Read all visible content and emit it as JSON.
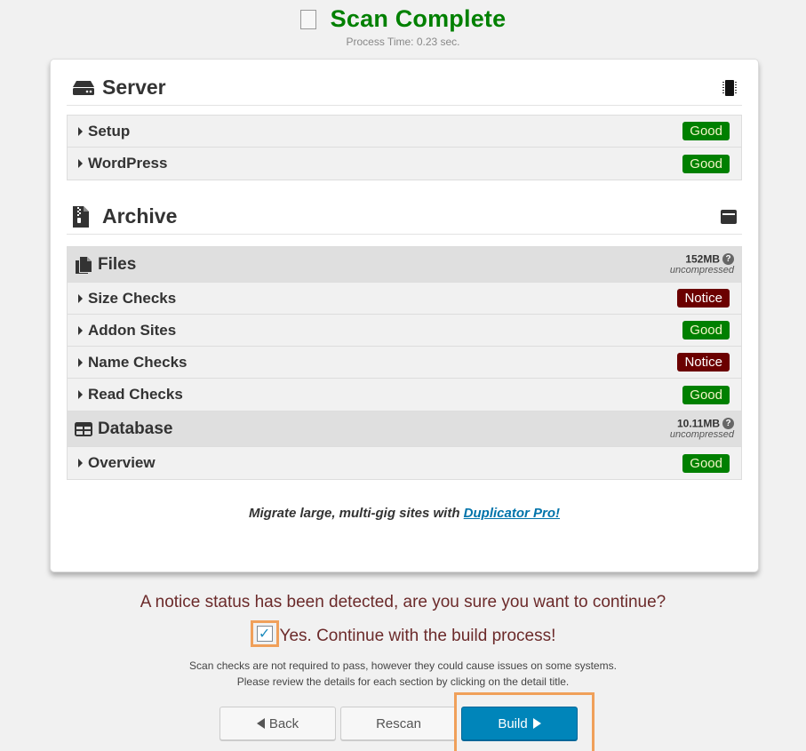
{
  "header": {
    "title": "Scan Complete",
    "process_time": "Process Time: 0.23 sec."
  },
  "server": {
    "title": "Server",
    "icon": "server-icon",
    "right_icon": "chip-icon",
    "items": [
      {
        "label": "Setup",
        "status": "Good"
      },
      {
        "label": "WordPress",
        "status": "Good"
      }
    ]
  },
  "archive": {
    "title": "Archive",
    "icon": "zip-file-icon",
    "right_icon": "hard-drive-icon",
    "files": {
      "label": "Files",
      "icon": "copy-files-icon",
      "size": "152MB",
      "size_note": "uncompressed",
      "items": [
        {
          "label": "Size Checks",
          "status": "Notice"
        },
        {
          "label": "Addon Sites",
          "status": "Good"
        },
        {
          "label": "Name Checks",
          "status": "Notice"
        },
        {
          "label": "Read Checks",
          "status": "Good"
        }
      ]
    },
    "database": {
      "label": "Database",
      "icon": "table-icon",
      "size": "10.11MB",
      "size_note": "uncompressed",
      "items": [
        {
          "label": "Overview",
          "status": "Good"
        }
      ]
    }
  },
  "promo": {
    "text": "Migrate large, multi-gig sites with ",
    "link": "Duplicator Pro!"
  },
  "notice": {
    "question": "A notice status has been detected, are you sure you want to continue?",
    "confirm_label": "Yes. Continue with the build process!",
    "confirm_checked": true
  },
  "fine_print": {
    "line1": "Scan checks are not required to pass, however they could cause issues on some systems.",
    "line2": "Please review the details for each section by clicking on the detail title."
  },
  "buttons": {
    "back": "Back",
    "rescan": "Rescan",
    "build": "Build"
  },
  "colors": {
    "title_green": "#008000",
    "good_badge": "#008000",
    "notice_badge": "#6b0000",
    "build_button": "#0085ba",
    "highlight": "#f0a05a",
    "link": "#0073aa"
  }
}
